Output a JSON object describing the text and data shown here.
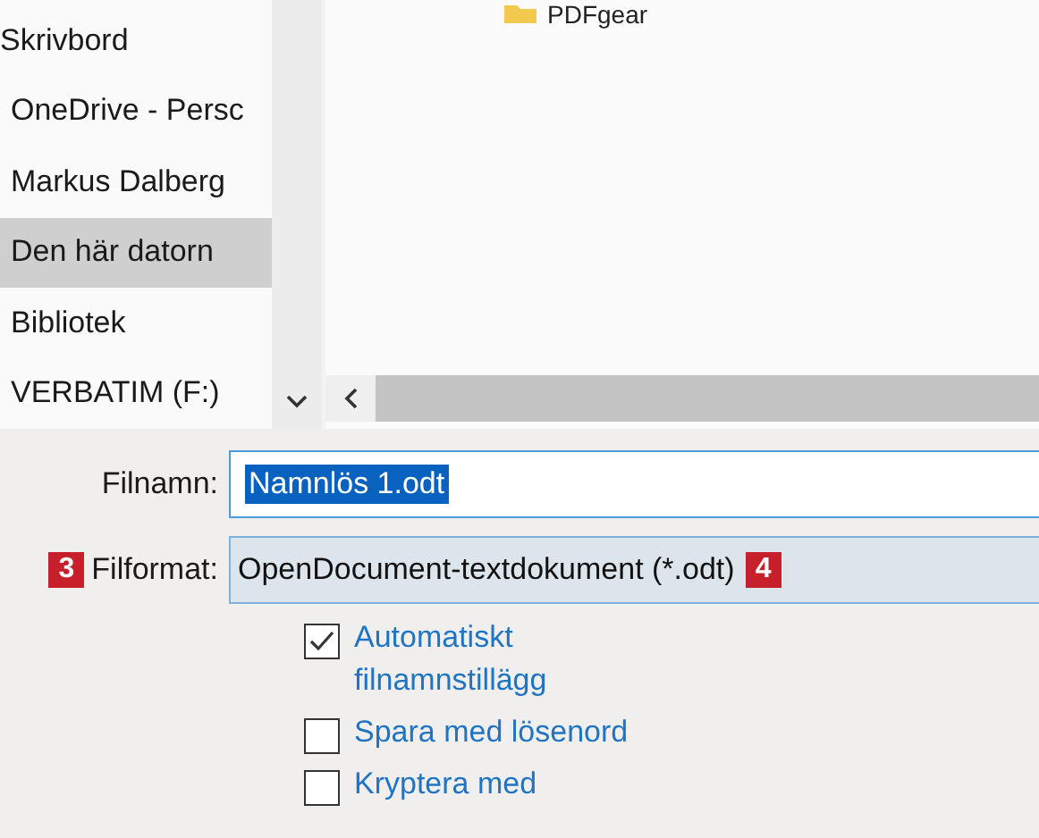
{
  "file_list": {
    "items": [
      {
        "name": "PDFgear"
      }
    ]
  },
  "nav": {
    "items": [
      {
        "label": "Skrivbord",
        "selected": false
      },
      {
        "label": "OneDrive - Persc",
        "selected": false
      },
      {
        "label": "Markus Dalberg",
        "selected": false
      },
      {
        "label": "Den här datorn",
        "selected": true
      },
      {
        "label": "Bibliotek",
        "selected": false
      },
      {
        "label": "VERBATIM (F:)",
        "selected": false
      }
    ]
  },
  "form": {
    "filename": {
      "label": "Filnamn:",
      "value": "Namnlös 1.odt",
      "selected": true
    },
    "format": {
      "label": "Filformat:",
      "value": "OpenDocument-textdokument (*.odt)",
      "badge_before": "3",
      "badge_after": "4"
    }
  },
  "options": [
    {
      "label": "Automatiskt filnamnstillägg",
      "checked": true
    },
    {
      "label": "Spara med lösenord",
      "checked": false
    },
    {
      "label": "Kryptera med",
      "checked": false
    }
  ]
}
